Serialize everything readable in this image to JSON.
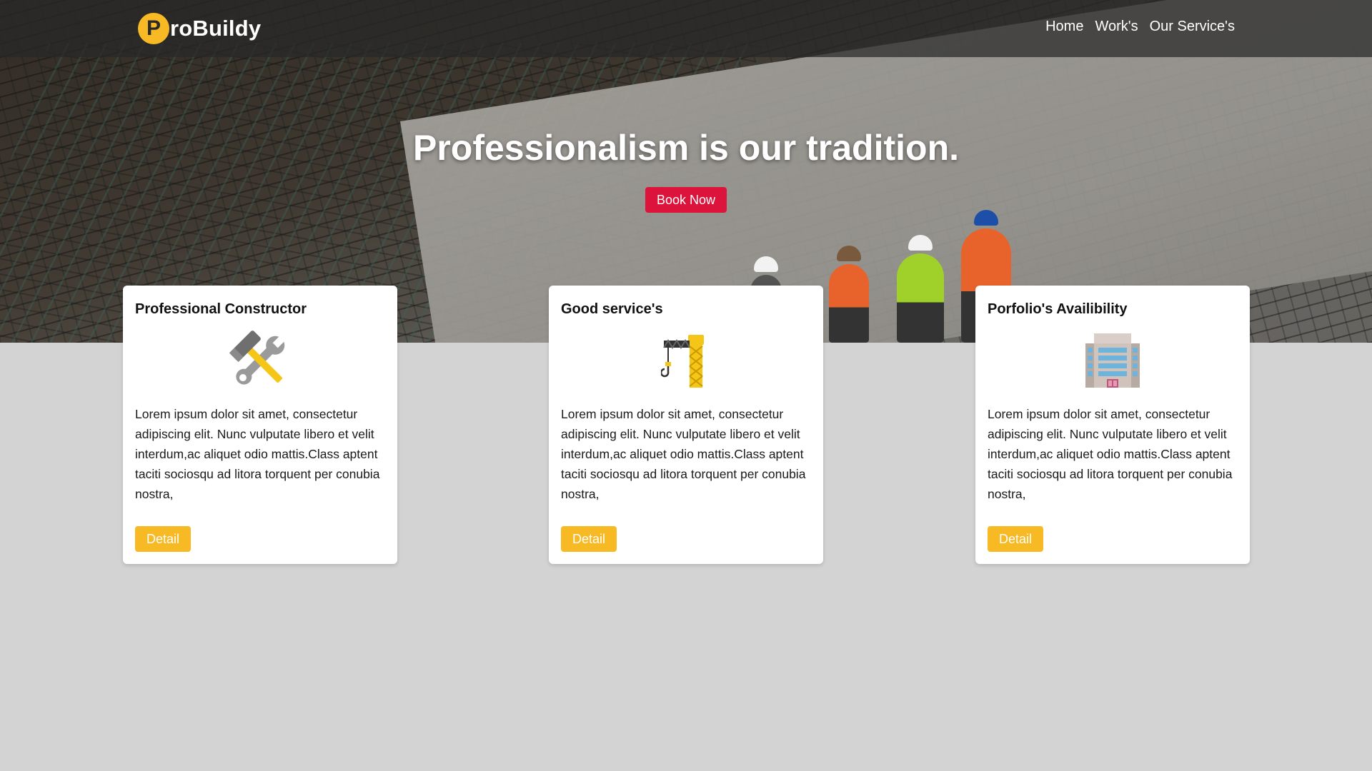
{
  "header": {
    "logo_letter": "P",
    "logo_text": "roBuildy",
    "nav": [
      {
        "label": "Home"
      },
      {
        "label": "Work's"
      },
      {
        "label": "Our Service's"
      }
    ]
  },
  "hero": {
    "title": "Professionalism is our tradition.",
    "cta_label": "Book Now"
  },
  "cards": [
    {
      "title": "Professional Constructor",
      "icon": "hammer-and-wrench-icon",
      "text": "Lorem ipsum dolor sit amet, consectetur adipiscing elit. Nunc vulputate libero et velit interdum,ac aliquet odio mattis.Class aptent taciti sociosqu ad litora torquent per conubia nostra,",
      "button_label": "Detail"
    },
    {
      "title": "Good service's",
      "icon": "crane-icon",
      "text": "Lorem ipsum dolor sit amet, consectetur adipiscing elit. Nunc vulputate libero et velit interdum,ac aliquet odio mattis.Class aptent taciti sociosqu ad litora torquent per conubia nostra,",
      "button_label": "Detail"
    },
    {
      "title": "Porfolio's Availibility",
      "icon": "office-building-icon",
      "text": "Lorem ipsum dolor sit amet, consectetur adipiscing elit. Nunc vulputate libero et velit interdum,ac aliquet odio mattis.Class aptent taciti sociosqu ad litora torquent per conubia nostra,",
      "button_label": "Detail"
    }
  ],
  "colors": {
    "accent_yellow": "#f7b924",
    "cta_red": "#dc143c",
    "page_background": "#d3d3d3",
    "navbar_background": "#282828"
  }
}
